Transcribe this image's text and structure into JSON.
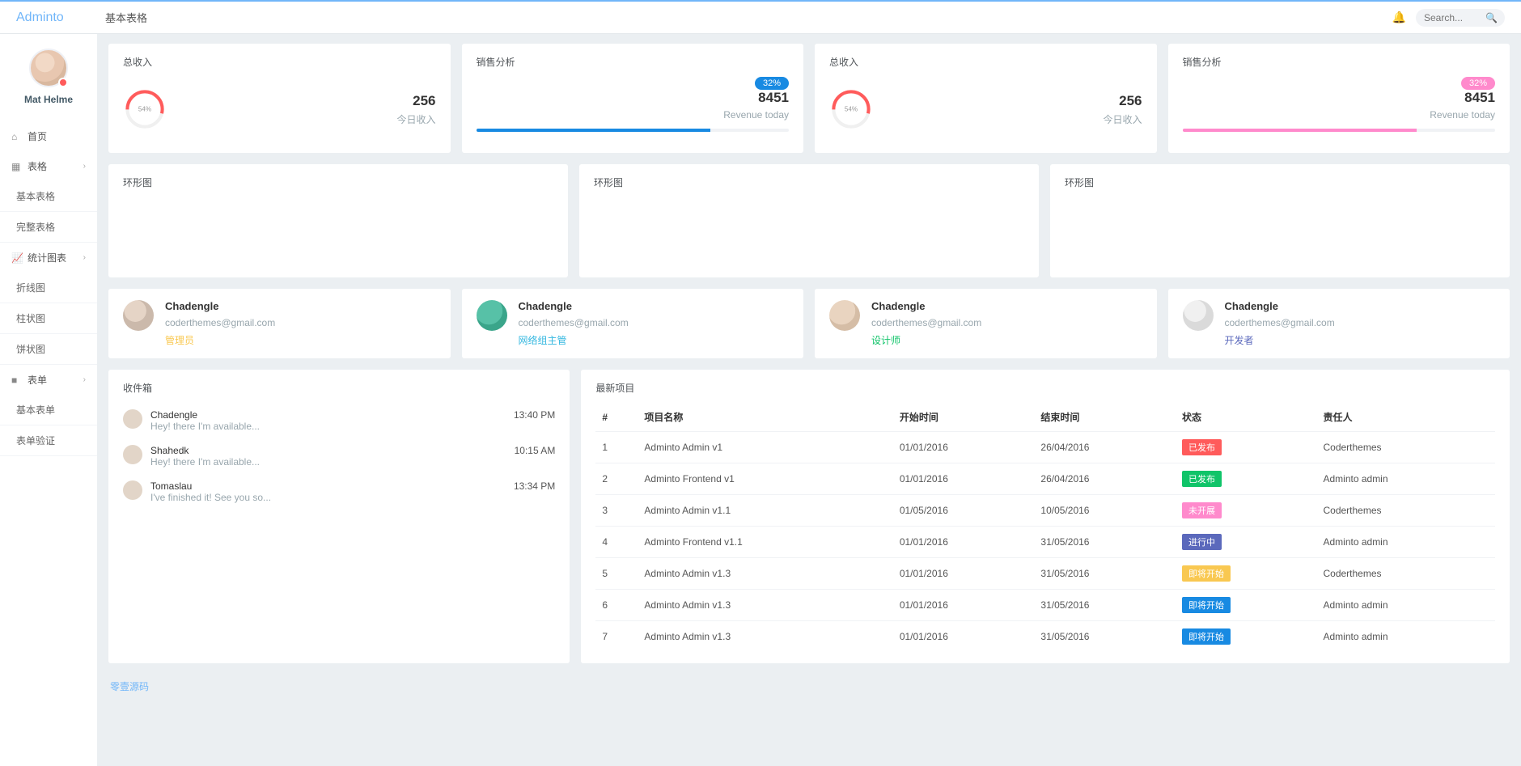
{
  "brand": "Adminto",
  "page_title": "基本表格",
  "search_placeholder": "Search...",
  "user": {
    "name": "Mat Helme"
  },
  "nav": {
    "home": "首页",
    "tables": "表格",
    "tables_sub": {
      "basic": "基本表格",
      "full": "完整表格"
    },
    "charts": "统计图表",
    "charts_sub": {
      "line": "折线图",
      "bar": "柱状图",
      "pie": "饼状图"
    },
    "forms": "表单",
    "forms_sub": {
      "basic": "基本表单",
      "validate": "表单验证"
    }
  },
  "cards": {
    "income": {
      "title": "总收入",
      "value": "256",
      "sub": "今日收入",
      "pct": "54%"
    },
    "sales": {
      "title": "销售分析",
      "badge": "32%",
      "value": "8451",
      "sub": "Revenue today"
    },
    "ring_title": "环形图"
  },
  "users": [
    {
      "name": "Chadengle",
      "email": "coderthemes@gmail.com",
      "role": "管理员",
      "role_cls": "role-admin",
      "av_cls": ""
    },
    {
      "name": "Chadengle",
      "email": "coderthemes@gmail.com",
      "role": "网络组主管",
      "role_cls": "role-net",
      "av_cls": "c2"
    },
    {
      "name": "Chadengle",
      "email": "coderthemes@gmail.com",
      "role": "设计师",
      "role_cls": "role-des",
      "av_cls": "c3"
    },
    {
      "name": "Chadengle",
      "email": "coderthemes@gmail.com",
      "role": "开发者",
      "role_cls": "role-dev",
      "av_cls": "c4"
    }
  ],
  "inbox": {
    "title": "收件箱",
    "items": [
      {
        "name": "Chadengle",
        "msg": "Hey! there I'm available...",
        "time": "13:40 PM"
      },
      {
        "name": "Shahedk",
        "msg": "Hey! there I'm available...",
        "time": "10:15 AM"
      },
      {
        "name": "Tomaslau",
        "msg": "I've finished it! See you so...",
        "time": "13:34 PM"
      }
    ]
  },
  "project_table": {
    "title": "最新项目",
    "headers": {
      "idx": "#",
      "name": "项目名称",
      "start": "开始时间",
      "end": "结束时间",
      "status": "状态",
      "owner": "责任人"
    },
    "rows": [
      {
        "idx": "1",
        "name": "Adminto Admin v1",
        "start": "01/01/2016",
        "end": "26/04/2016",
        "status": "已发布",
        "status_cls": "b-red",
        "owner": "Coderthemes"
      },
      {
        "idx": "2",
        "name": "Adminto Frontend v1",
        "start": "01/01/2016",
        "end": "26/04/2016",
        "status": "已发布",
        "status_cls": "b-green",
        "owner": "Adminto admin"
      },
      {
        "idx": "3",
        "name": "Adminto Admin v1.1",
        "start": "01/05/2016",
        "end": "10/05/2016",
        "status": "未开展",
        "status_cls": "b-pink",
        "owner": "Coderthemes"
      },
      {
        "idx": "4",
        "name": "Adminto Frontend v1.1",
        "start": "01/01/2016",
        "end": "31/05/2016",
        "status": "进行中",
        "status_cls": "b-purple",
        "owner": "Adminto admin"
      },
      {
        "idx": "5",
        "name": "Adminto Admin v1.3",
        "start": "01/01/2016",
        "end": "31/05/2016",
        "status": "即将开始",
        "status_cls": "b-yellow",
        "owner": "Coderthemes"
      },
      {
        "idx": "6",
        "name": "Adminto Admin v1.3",
        "start": "01/01/2016",
        "end": "31/05/2016",
        "status": "即将开始",
        "status_cls": "b-blue",
        "owner": "Adminto admin"
      },
      {
        "idx": "7",
        "name": "Adminto Admin v1.3",
        "start": "01/01/2016",
        "end": "31/05/2016",
        "status": "即将开始",
        "status_cls": "b-blue",
        "owner": "Adminto admin"
      }
    ]
  },
  "footer_link": "零壹源码",
  "chart_data": {
    "income_circle": {
      "type": "pie",
      "pct": 54,
      "label": "54%",
      "color": "#ff5b5b"
    },
    "sales_progress_1": {
      "type": "bar",
      "pct": 75,
      "color": "#188ae2"
    },
    "sales_progress_2": {
      "type": "bar",
      "pct": 75,
      "color": "#ff8acc"
    }
  }
}
